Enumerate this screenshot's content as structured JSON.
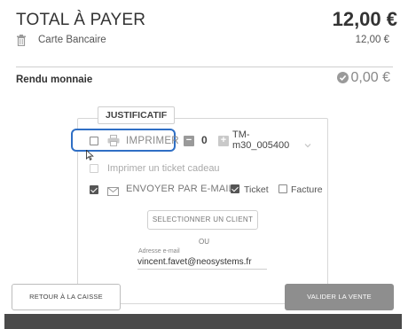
{
  "total": {
    "label": "TOTAL À PAYER",
    "amount": "12,00 €"
  },
  "payment": {
    "method": "Carte Bancaire",
    "amount": "12,00 €",
    "icon": "trash-icon"
  },
  "change": {
    "label": "Rendu monnaie",
    "amount": "0,00 €",
    "icon": "check-circle-icon"
  },
  "receipt": {
    "legend": "JUSTIFICATIF",
    "print": {
      "label": "IMPRIMER",
      "checked": false,
      "icon": "printer-icon"
    },
    "quantity": "0",
    "printer": "TM-m30_005400",
    "gift": {
      "label": "Imprimer un ticket cadeau",
      "checked": false
    },
    "email": {
      "label": "ENVOYER PAR E-MAIL",
      "checked": true,
      "icon": "mail-icon"
    },
    "ticket": {
      "label": "Ticket",
      "checked": true
    },
    "invoice": {
      "label": "Facture",
      "checked": false
    },
    "select_client": "SELECTIONNER UN CLIENT",
    "or": "OU",
    "email_field_label": "Adresse e-mail",
    "email_value": "vincent.favet@neosystems.fr"
  },
  "actions": {
    "back": "RETOUR À LA CAISSE",
    "validate": "VALIDER LA VENTE"
  },
  "colors": {
    "highlight": "#2f6fc5",
    "validate_bg": "#8e8e8e",
    "bottom_bar": "#4a4a4a"
  }
}
